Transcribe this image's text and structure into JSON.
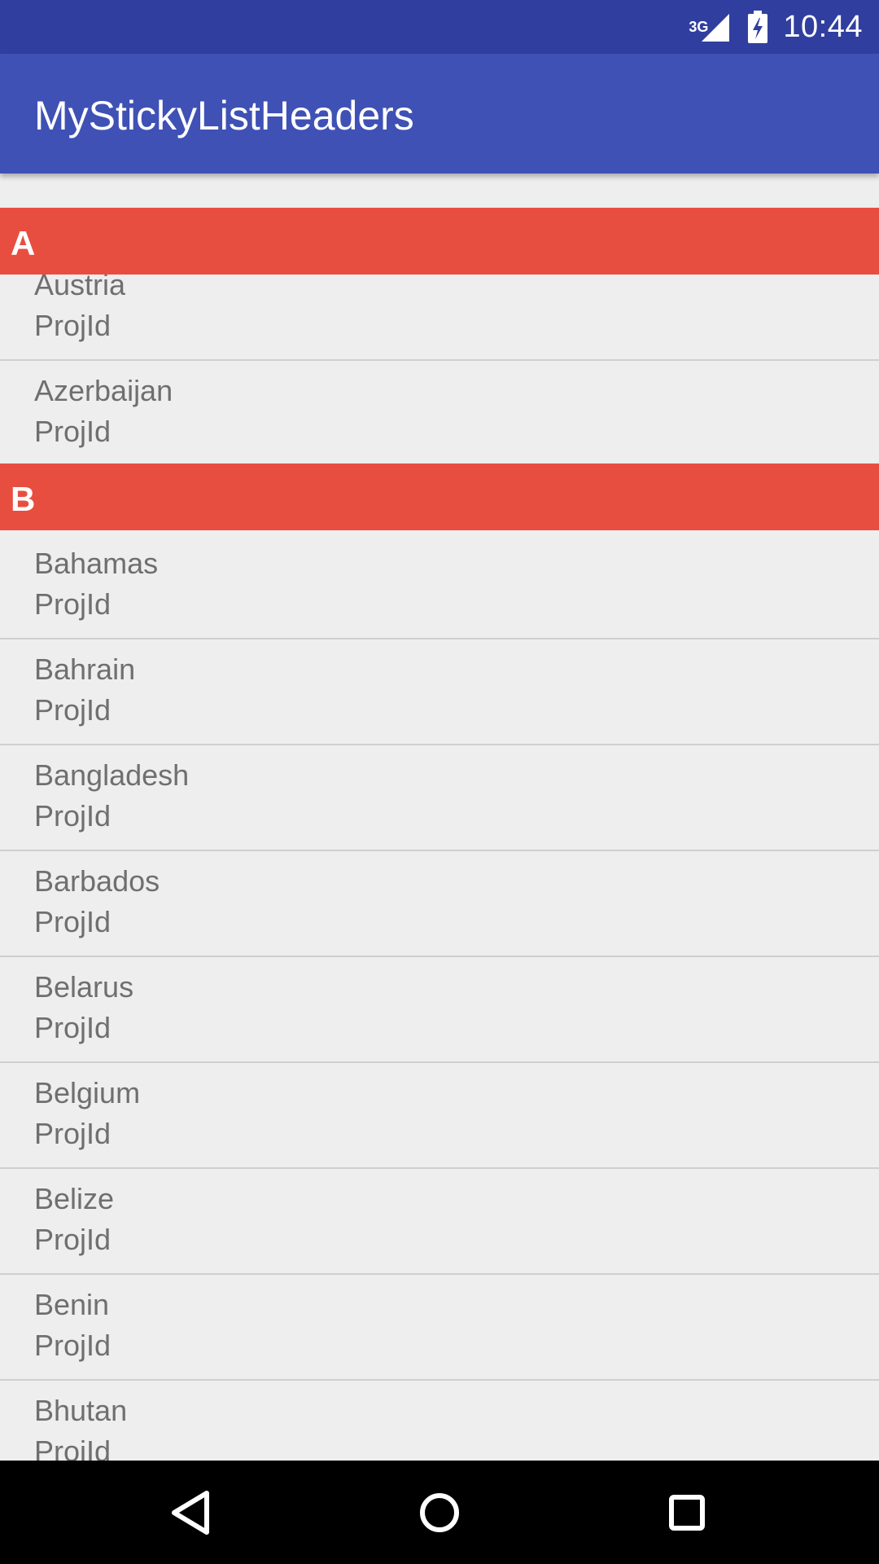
{
  "status_bar": {
    "network_type": "3G",
    "time": "10:44",
    "signal_icon": "cell-signal-icon",
    "battery_icon": "battery-charging-icon"
  },
  "app_bar": {
    "title": "MyStickyListHeaders"
  },
  "colors": {
    "status_bar": "#303f9f",
    "app_bar": "#3f51b5",
    "section_header": "#e84e40",
    "background": "#eeeeee",
    "item_text": "#6f6f6f"
  },
  "list": {
    "sections": [
      {
        "letter": "A",
        "items": [
          {
            "name": "Austria",
            "sub": "ProjId"
          },
          {
            "name": "Azerbaijan",
            "sub": "ProjId"
          }
        ]
      },
      {
        "letter": "B",
        "items": [
          {
            "name": "Bahamas",
            "sub": "ProjId"
          },
          {
            "name": "Bahrain",
            "sub": "ProjId"
          },
          {
            "name": "Bangladesh",
            "sub": "ProjId"
          },
          {
            "name": "Barbados",
            "sub": "ProjId"
          },
          {
            "name": "Belarus",
            "sub": "ProjId"
          },
          {
            "name": "Belgium",
            "sub": "ProjId"
          },
          {
            "name": "Belize",
            "sub": "ProjId"
          },
          {
            "name": "Benin",
            "sub": "ProjId"
          },
          {
            "name": "Bhutan",
            "sub": "ProjId"
          }
        ]
      }
    ]
  },
  "nav_bar": {
    "back_icon": "back-triangle-icon",
    "home_icon": "home-circle-icon",
    "recents_icon": "recents-square-icon"
  }
}
